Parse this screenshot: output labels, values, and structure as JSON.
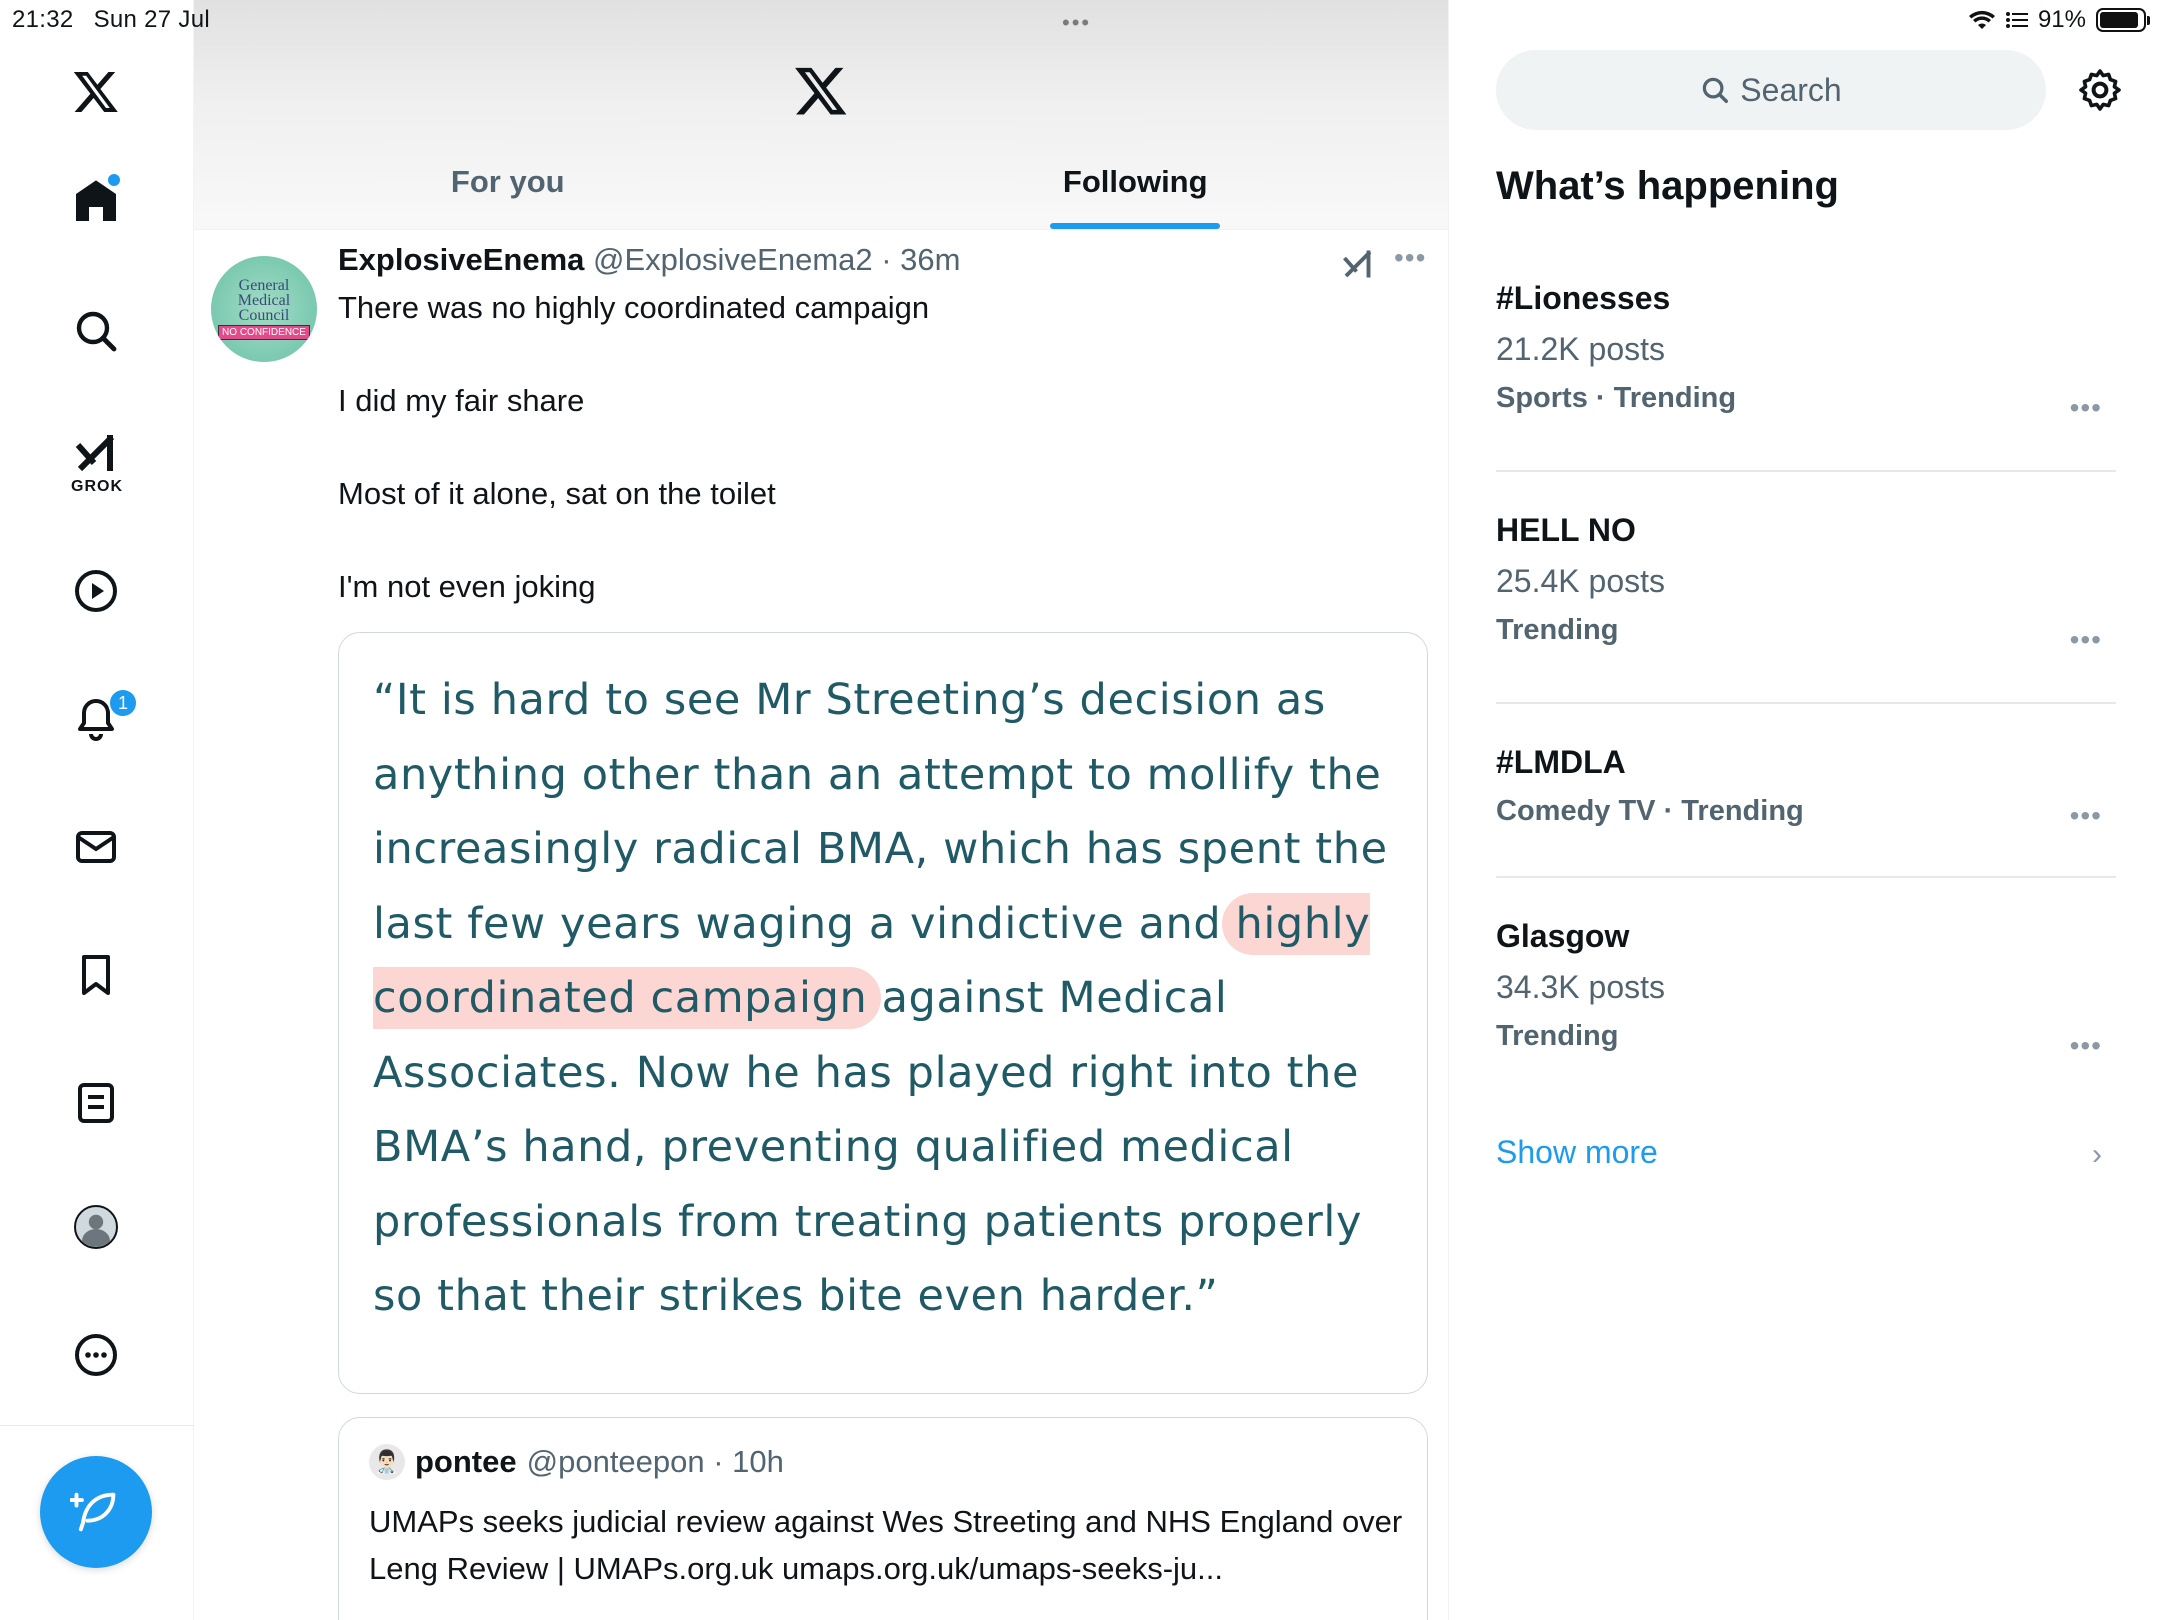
{
  "status_bar": {
    "time": "21:32",
    "date": "Sun 27 Jul",
    "multitask_dots": "•••",
    "battery_percent": "91%",
    "battery_level": 0.91
  },
  "nav": {
    "items": [
      {
        "name": "home",
        "icon": "home-icon",
        "has_dot": true
      },
      {
        "name": "explore",
        "icon": "search-icon"
      },
      {
        "name": "grok",
        "icon": "grok-icon",
        "label": "GROK"
      },
      {
        "name": "video",
        "icon": "play-icon"
      },
      {
        "name": "notifications",
        "icon": "bell-icon",
        "badge": "1"
      },
      {
        "name": "messages",
        "icon": "mail-icon"
      },
      {
        "name": "bookmarks",
        "icon": "bookmark-icon"
      },
      {
        "name": "lists",
        "icon": "list-icon"
      },
      {
        "name": "profile",
        "icon": "avatar-icon"
      },
      {
        "name": "more",
        "icon": "more-circle-icon"
      }
    ],
    "compose_icon": "compose-feather-icon"
  },
  "feed": {
    "tabs": [
      {
        "label": "For you",
        "active": false
      },
      {
        "label": "Following",
        "active": true
      }
    ],
    "accent": "#1d9bf0"
  },
  "post": {
    "display_name": "ExplosiveEnema",
    "handle_time": "@ExplosiveEnema2 · 36m",
    "avatar_text": {
      "line1": "General",
      "line2": "Medical",
      "line3": "Council",
      "stamp": "NO CONFIDENCE"
    },
    "text_lines": [
      "There was no highly coordinated campaign",
      "I did my fair share",
      "Most of it alone, sat on the toilet",
      "I'm not even joking"
    ],
    "image_quote": {
      "before": "“It is hard to see Mr Streeting’s decision as anything other than an attempt to mollify the increasingly radical BMA, which has spent the last few years waging a vindictive and ",
      "highlight": "highly coordinated campaign",
      "after": " against Medical Associates. Now he has played right into the BMA’s hand, preventing qualified medical professionals from treating patients properly so that their strikes bite even harder.”",
      "text_color": "#1f5a66",
      "highlight_color": "#fcd6d2"
    },
    "quoted_post": {
      "avatar_emoji": "👨🏻‍⚕️",
      "display_name": "pontee",
      "handle_time": "@ponteepon · 10h",
      "text": "UMAPs seeks judicial review against Wes Streeting and NHS England over Leng Review | UMAPs.org.uk umaps.org.uk/umaps-seeks-ju..."
    }
  },
  "sidebar": {
    "search_placeholder": "Search",
    "title": "What’s happening",
    "trends": [
      {
        "name": "#Lionesses",
        "count": "21.2K posts",
        "category": "Sports · Trending"
      },
      {
        "name": "HELL NO",
        "count": "25.4K posts",
        "category": "Trending"
      },
      {
        "name": "#LMDLA",
        "count": "",
        "category": "Comedy TV · Trending"
      },
      {
        "name": "Glasgow",
        "count": "34.3K posts",
        "category": "Trending"
      }
    ],
    "show_more": "Show more",
    "more_label": "•••"
  }
}
